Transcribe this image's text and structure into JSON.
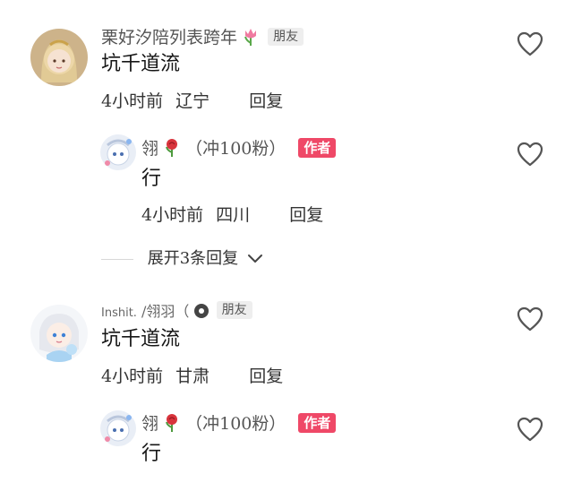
{
  "comments": [
    {
      "username": "栗好汐陪列表跨年",
      "friend_badge": "朋友",
      "text": "坑千道流",
      "time": "4小时前",
      "location": "辽宁",
      "reply": "回复",
      "replies": [
        {
          "username": "翎",
          "username_suffix": "（冲100粉）",
          "author_badge": "作者",
          "text": "行",
          "time": "4小时前",
          "location": "四川",
          "reply": "回复"
        }
      ],
      "expand_label": "展开3条回复"
    },
    {
      "username": "Inshit.",
      "username_sep": "/翎羽（",
      "friend_badge": "朋友",
      "text": "坑千道流",
      "time": "4小时前",
      "location": "甘肃",
      "reply": "回复",
      "replies": [
        {
          "username": "翎",
          "username_suffix": "（冲100粉）",
          "author_badge": "作者",
          "text": "行"
        }
      ]
    }
  ],
  "colors": {
    "author_badge": "#ef4867",
    "friend_badge_bg": "#eeeeee",
    "heart_stroke": "#555555"
  }
}
